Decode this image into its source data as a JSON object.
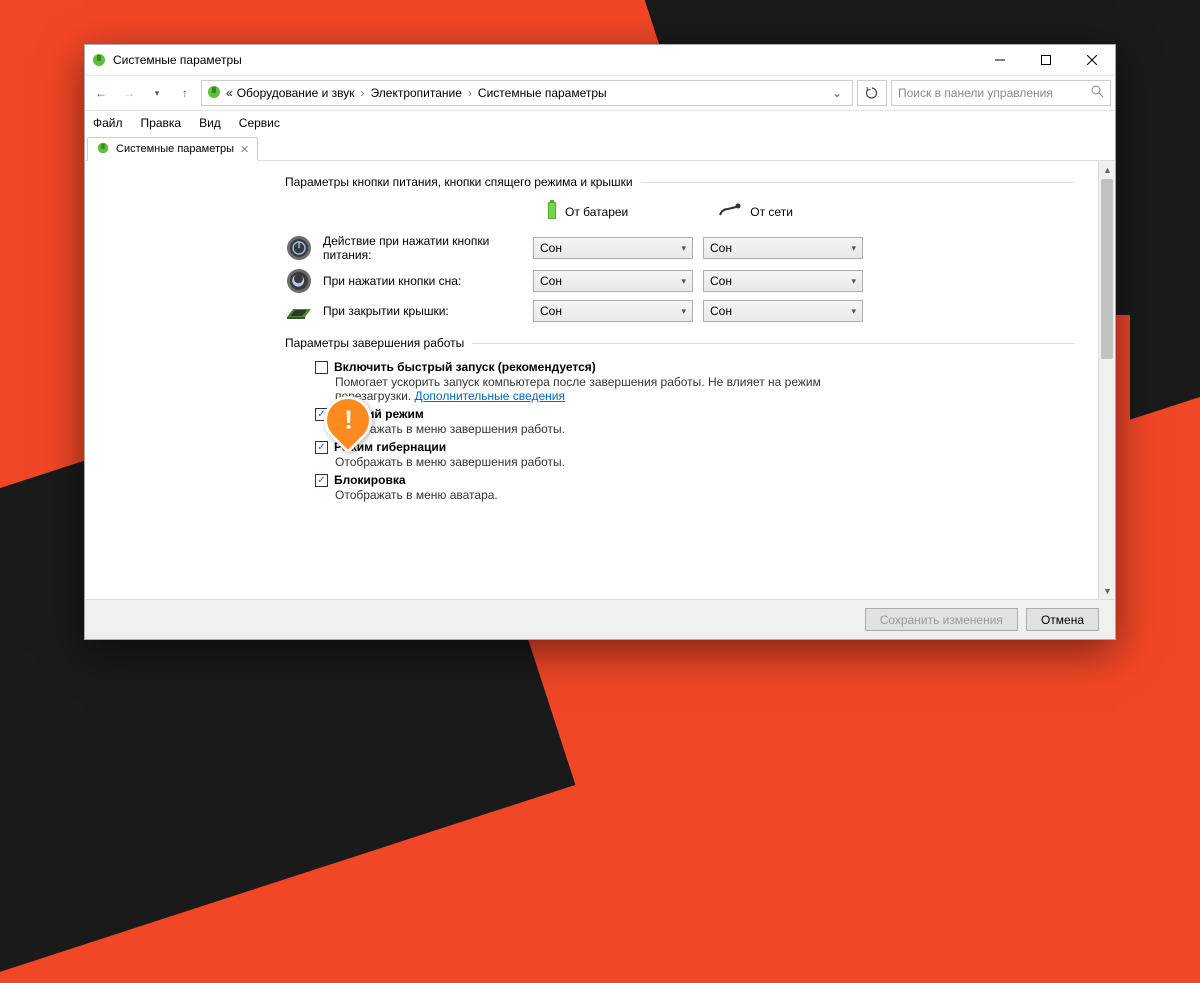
{
  "window": {
    "title": "Системные параметры"
  },
  "breadcrumbs": {
    "b0": "«",
    "b1": "Оборудование и звук",
    "b2": "Электропитание",
    "b3": "Системные параметры"
  },
  "search": {
    "placeholder": "Поиск в панели управления"
  },
  "menu": {
    "file": "Файл",
    "edit": "Правка",
    "view": "Вид",
    "service": "Сервис"
  },
  "tab": {
    "label": "Системные параметры"
  },
  "section1": {
    "title": "Параметры кнопки питания, кнопки спящего режима и крышки"
  },
  "columns": {
    "battery": "От батареи",
    "plugged": "От сети"
  },
  "rows": {
    "power": {
      "label": "Действие при нажатии кнопки питания:",
      "battery": "Сон",
      "plugged": "Сон"
    },
    "sleep": {
      "label": "При нажатии кнопки сна:",
      "battery": "Сон",
      "plugged": "Сон"
    },
    "lid": {
      "label": "При закрытии крышки:",
      "battery": "Сон",
      "plugged": "Сон"
    }
  },
  "section2": {
    "title": "Параметры завершения работы"
  },
  "checks": {
    "fast": {
      "label": "Включить быстрый запуск (рекомендуется)",
      "desc": "Помогает ускорить запуск компьютера после завершения работы. Не влияет на режим перезагрузки. ",
      "link": "Дополнительные сведения"
    },
    "sleep": {
      "label": "Спящий режим",
      "desc": "Отображать в меню завершения работы."
    },
    "hibernate": {
      "label": "Режим гибернации",
      "desc": "Отображать в меню завершения работы."
    },
    "lock": {
      "label": "Блокировка",
      "desc": "Отображать в меню аватара."
    }
  },
  "footer": {
    "save": "Сохранить изменения",
    "cancel": "Отмена"
  }
}
